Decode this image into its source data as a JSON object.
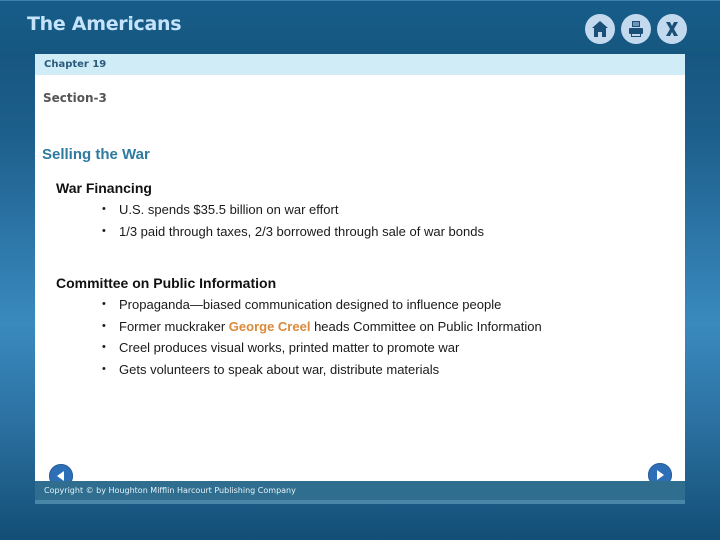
{
  "app": {
    "title": "The Americans"
  },
  "toolbar": {
    "icons": [
      {
        "name": "home-icon",
        "label": "Home"
      },
      {
        "name": "print-icon",
        "label": "Print"
      },
      {
        "name": "close-icon",
        "label": "X"
      }
    ]
  },
  "slide": {
    "chapter": "Chapter 19",
    "section": "Section-3",
    "title": "Selling the War",
    "groups": [
      {
        "heading": "War Financing",
        "bullets": [
          "U.S. spends $35.5 billion on war effort",
          "1/3 paid through taxes, 2/3 borrowed through sale of war bonds"
        ]
      },
      {
        "heading": "Committee on Public Information",
        "bullets": [
          "Propaganda—biased communication designed to influence people",
          {
            "prefix": "Former muckraker ",
            "highlight": "George Creel",
            "suffix": " heads Committee on Public Information"
          },
          "Creel produces visual works, printed matter to promote war",
          "Gets volunteers to speak about war, distribute materials"
        ]
      }
    ],
    "bullet_char": "•"
  },
  "nav": {
    "previous": "Previous",
    "next": "Next"
  },
  "footer": {
    "copyright": "Copyright © by Houghton Mifflin Harcourt Publishing Company"
  },
  "colors": {
    "highlight": "#d98a3a",
    "title": "#2e7aa0",
    "header_bg": "#175d8a"
  }
}
